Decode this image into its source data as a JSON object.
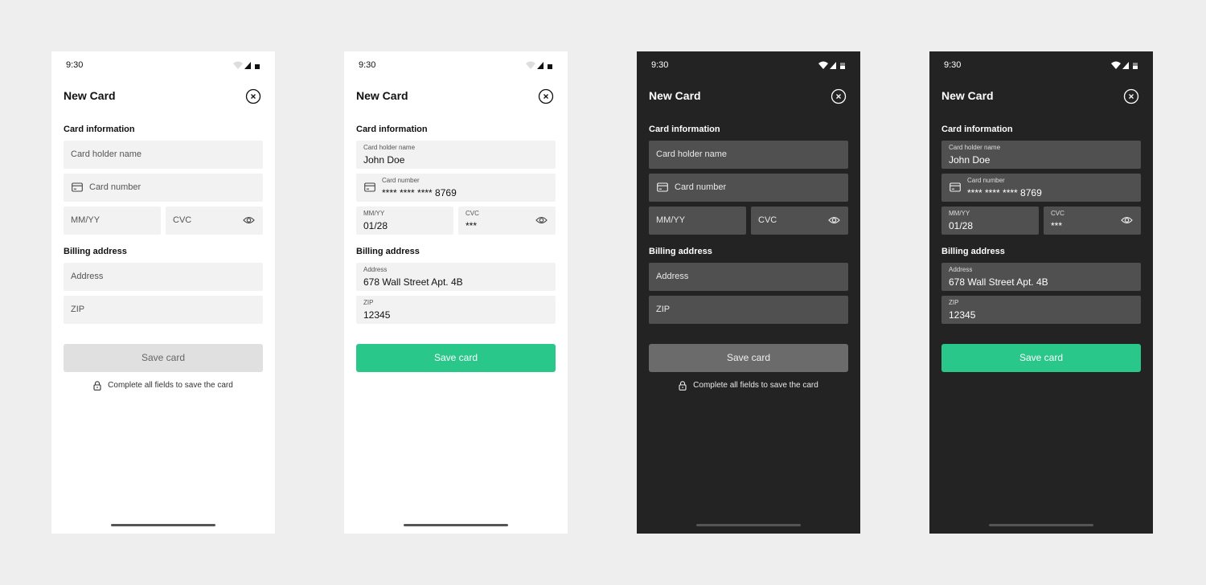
{
  "colors": {
    "page_background": "#eeeeee",
    "light_surface": "#ffffff",
    "dark_surface": "#232323",
    "light_field": "#f2f2f2",
    "dark_field": "#505050",
    "accent_green": "#2ac78b",
    "disabled_light": "#e0e0e0",
    "disabled_dark": "#6b6b6b"
  },
  "status_icons": [
    "wifi-icon",
    "signal-icon",
    "battery-icon"
  ],
  "screens": [
    {
      "theme": "light",
      "state": "empty",
      "status_time": "9:30",
      "title": "New Card",
      "card_section_label": "Card information",
      "billing_section_label": "Billing address",
      "card_holder": {
        "placeholder": "Card holder name"
      },
      "card_number": {
        "placeholder": "Card number"
      },
      "expiry": {
        "placeholder": "MM/YY"
      },
      "cvc": {
        "placeholder": "CVC"
      },
      "address": {
        "placeholder": "Address"
      },
      "zip": {
        "placeholder": "ZIP"
      },
      "save_label": "Save card",
      "hint": "Complete all fields to save the card"
    },
    {
      "theme": "light",
      "state": "filled",
      "status_time": "9:30",
      "title": "New Card",
      "card_section_label": "Card information",
      "billing_section_label": "Billing address",
      "card_holder": {
        "label": "Card holder name",
        "value": "John Doe"
      },
      "card_number": {
        "label": "Card number",
        "value": "**** **** **** 8769"
      },
      "expiry": {
        "label": "MM/YY",
        "value": "01/28"
      },
      "cvc": {
        "label": "CVC",
        "value": "***"
      },
      "address": {
        "label": "Address",
        "value": "678 Wall Street Apt. 4B"
      },
      "zip": {
        "label": "ZIP",
        "value": "12345"
      },
      "save_label": "Save card"
    },
    {
      "theme": "dark",
      "state": "empty",
      "status_time": "9:30",
      "title": "New Card",
      "card_section_label": "Card information",
      "billing_section_label": "Billing address",
      "card_holder": {
        "placeholder": "Card holder name"
      },
      "card_number": {
        "placeholder": "Card number"
      },
      "expiry": {
        "placeholder": "MM/YY"
      },
      "cvc": {
        "placeholder": "CVC"
      },
      "address": {
        "placeholder": "Address"
      },
      "zip": {
        "placeholder": "ZIP"
      },
      "save_label": "Save card",
      "hint": "Complete all fields to save the card"
    },
    {
      "theme": "dark",
      "state": "filled",
      "status_time": "9:30",
      "title": "New Card",
      "card_section_label": "Card information",
      "billing_section_label": "Billing address",
      "card_holder": {
        "label": "Card holder name",
        "value": "John Doe"
      },
      "card_number": {
        "label": "Card number",
        "value": "**** **** **** 8769"
      },
      "expiry": {
        "label": "MM/YY",
        "value": "01/28"
      },
      "cvc": {
        "label": "CVC",
        "value": "***"
      },
      "address": {
        "label": "Address",
        "value": "678 Wall Street Apt. 4B"
      },
      "zip": {
        "label": "ZIP",
        "value": "12345"
      },
      "save_label": "Save card"
    }
  ]
}
